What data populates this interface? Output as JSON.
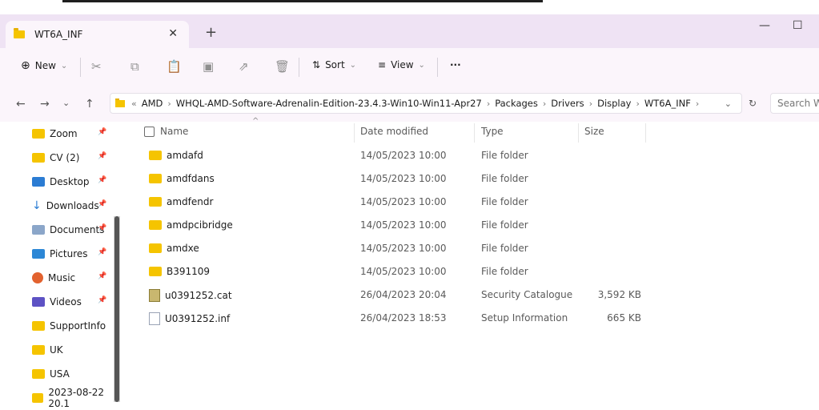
{
  "tab": {
    "title": "WT6A_INF"
  },
  "toolbar": {
    "new": "New",
    "sort": "Sort",
    "view": "View",
    "more": "···"
  },
  "address": {
    "segments": [
      "AMD",
      "WHQL-AMD-Software-Adrenalin-Edition-23.4.3-Win10-Win11-Apr27",
      "Packages",
      "Drivers",
      "Display",
      "WT6A_INF"
    ],
    "search_placeholder": "Search W..."
  },
  "sidebar": {
    "items": [
      {
        "label": "Zoom",
        "icon": "folder-icon",
        "pinned": true
      },
      {
        "label": "CV (2)",
        "icon": "folder-icon",
        "pinned": true
      },
      {
        "label": "Desktop",
        "icon": "desktop-icon",
        "pinned": true
      },
      {
        "label": "Downloads",
        "icon": "download-icon",
        "pinned": true
      },
      {
        "label": "Documents",
        "icon": "documents-icon",
        "pinned": true
      },
      {
        "label": "Pictures",
        "icon": "pictures-icon",
        "pinned": true
      },
      {
        "label": "Music",
        "icon": "music-icon",
        "pinned": true
      },
      {
        "label": "Videos",
        "icon": "videos-icon",
        "pinned": true
      },
      {
        "label": "SupportInfo",
        "icon": "folder-icon",
        "pinned": false
      },
      {
        "label": "UK",
        "icon": "folder-icon",
        "pinned": false
      },
      {
        "label": "USA",
        "icon": "folder-icon",
        "pinned": false
      },
      {
        "label": "2023-08-22 20.1",
        "icon": "folder-icon",
        "pinned": false
      }
    ]
  },
  "columns": {
    "name": "Name",
    "date": "Date modified",
    "type": "Type",
    "size": "Size"
  },
  "files": [
    {
      "name": "amdafd",
      "date": "14/05/2023 10:00",
      "type": "File folder",
      "size": "",
      "icon": "folder-icon"
    },
    {
      "name": "amdfdans",
      "date": "14/05/2023 10:00",
      "type": "File folder",
      "size": "",
      "icon": "folder-icon"
    },
    {
      "name": "amdfendr",
      "date": "14/05/2023 10:00",
      "type": "File folder",
      "size": "",
      "icon": "folder-icon"
    },
    {
      "name": "amdpcibridge",
      "date": "14/05/2023 10:00",
      "type": "File folder",
      "size": "",
      "icon": "folder-icon"
    },
    {
      "name": "amdxe",
      "date": "14/05/2023 10:00",
      "type": "File folder",
      "size": "",
      "icon": "folder-icon"
    },
    {
      "name": "B391109",
      "date": "14/05/2023 10:00",
      "type": "File folder",
      "size": "",
      "icon": "folder-icon"
    },
    {
      "name": "u0391252.cat",
      "date": "26/04/2023 20:04",
      "type": "Security Catalogue",
      "size": "3,592 KB",
      "icon": "catalog-icon"
    },
    {
      "name": "U0391252.inf",
      "date": "26/04/2023 18:53",
      "type": "Setup Information",
      "size": "665 KB",
      "icon": "inf-file-icon"
    }
  ]
}
